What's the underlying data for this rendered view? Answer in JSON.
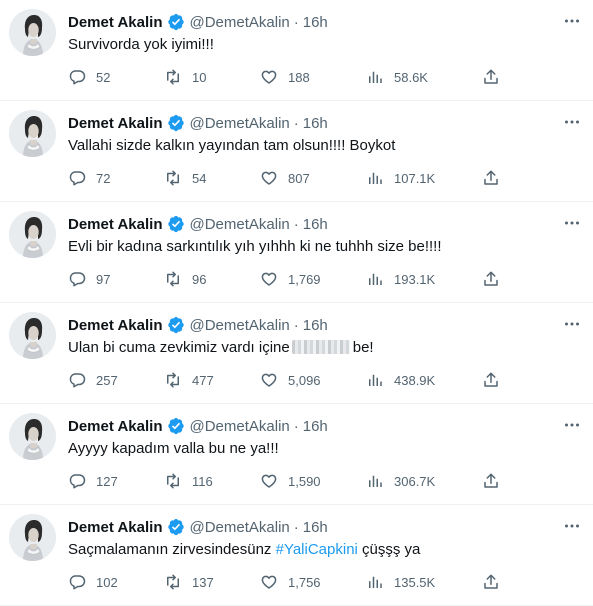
{
  "author": {
    "name": "Demet Akalin",
    "handle": "@DemetAkalin",
    "verified_icon": "verified-badge-icon",
    "accent_color": "#1d9bf0"
  },
  "tweets": [
    {
      "time": "16h",
      "text": "Survivorda yok iyimi!!!",
      "replies": "52",
      "retweets": "10",
      "likes": "188",
      "views": "58.6K"
    },
    {
      "time": "16h",
      "text": "Vallahi sizde kalkın yayından tam olsun!!!! Boykot",
      "replies": "72",
      "retweets": "54",
      "likes": "807",
      "views": "107.1K"
    },
    {
      "time": "16h",
      "text": "Evli bir kadına sarkıntılık yıh yıhhh ki ne tuhhh size be!!!!",
      "replies": "97",
      "retweets": "96",
      "likes": "1,769",
      "views": "193.1K"
    },
    {
      "time": "16h",
      "text_before": "Ulan bi cuma zevkimiz vardı içine",
      "text_after": "be!",
      "replies": "257",
      "retweets": "477",
      "likes": "5,096",
      "views": "438.9K"
    },
    {
      "time": "16h",
      "text": "Ayyyy kapadım valla bu ne ya!!!",
      "replies": "127",
      "retweets": "116",
      "likes": "1,590",
      "views": "306.7K"
    },
    {
      "time": "16h",
      "text_before": "Saçmalamanın zirvesindesünz",
      "hashtag": "#YaliCapkini",
      "text_after": "çüşşş ya",
      "replies": "102",
      "retweets": "137",
      "likes": "1,756",
      "views": "135.5K"
    }
  ]
}
